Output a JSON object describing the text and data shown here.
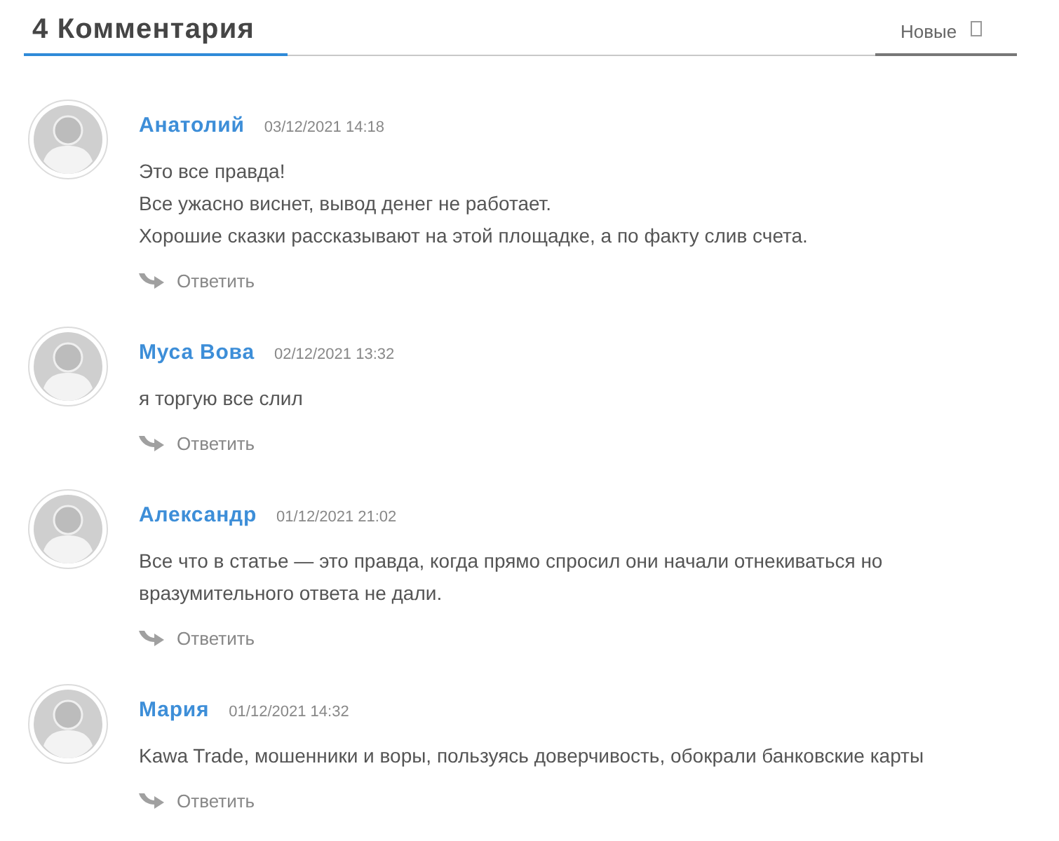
{
  "header": {
    "title": "4 Комментария",
    "sort_label": "Новые"
  },
  "comments": [
    {
      "author": "Анатолий",
      "date": "03/12/2021 14:18",
      "paragraphs": [
        "Это все правда!",
        "Все ужасно виснет, вывод денег не работает.",
        "Хорошие сказки рассказывают на этой площадке, а по факту слив счета."
      ],
      "reply": "Ответить"
    },
    {
      "author": "Муса Вова",
      "date": "02/12/2021 13:32",
      "paragraphs": [
        "я торгую все слил"
      ],
      "reply": "Ответить"
    },
    {
      "author": "Александр",
      "date": "01/12/2021 21:02",
      "paragraphs": [
        "Все что в статье — это правда, когда прямо спросил они начали отнекиваться но вразумительного ответа не дали."
      ],
      "reply": "Ответить"
    },
    {
      "author": "Мария",
      "date": "01/12/2021 14:32",
      "paragraphs": [
        "Kawa Trade, мошенники и воры, пользуясь доверчивость, обокрали банковские карты"
      ],
      "reply": "Ответить"
    }
  ]
}
